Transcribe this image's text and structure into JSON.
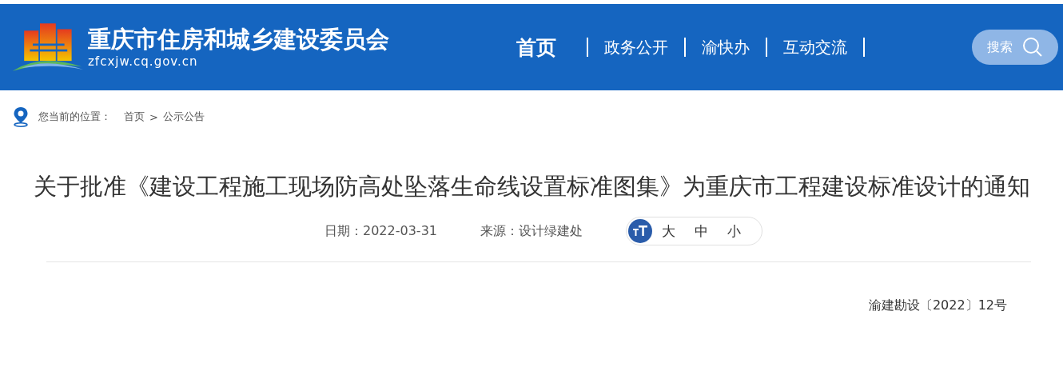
{
  "header": {
    "site_name": "重庆市住房和城乡建设委员会",
    "domain": "zfcxjw.cq.gov.cn",
    "nav": [
      {
        "label": "首页",
        "selected": true
      },
      {
        "label": "政务公开",
        "selected": false
      },
      {
        "label": "渝快办",
        "selected": false
      },
      {
        "label": "互动交流",
        "selected": false
      }
    ],
    "search_button": "搜索"
  },
  "breadcrumb": {
    "prefix": "您当前的位置：",
    "items": [
      "首页",
      "公示公告"
    ],
    "separator": ">"
  },
  "article": {
    "title": "关于批准《建设工程施工现场防高处坠落生命线设置标准图集》为重庆市工程建设标准设计的通知",
    "date": "日期：2022-03-31",
    "source": "来源：设计绿建处",
    "font_sizes": [
      {
        "label": "大",
        "selected": false
      },
      {
        "label": "中",
        "selected": false
      },
      {
        "label": "小",
        "selected": false
      }
    ],
    "doc_number": "渝建勘设〔2022〕12号"
  }
}
